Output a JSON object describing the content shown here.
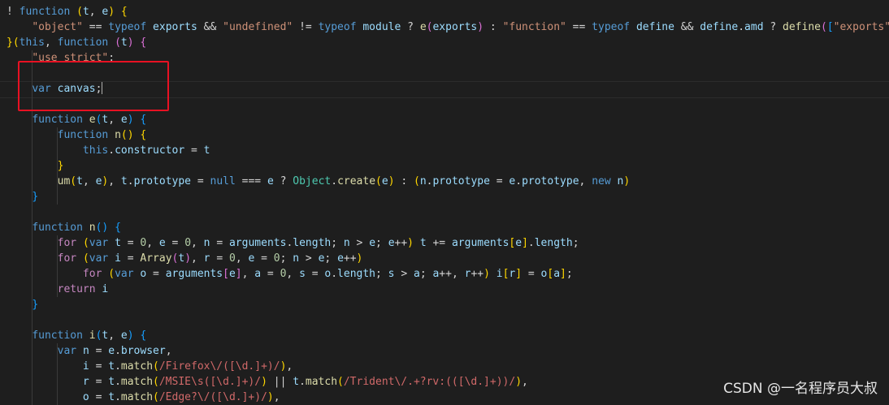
{
  "editor": {
    "language": "javascript",
    "theme": "dark",
    "cursor": {
      "line": 6,
      "after_text": "var canvas;"
    },
    "highlight": {
      "label": "red-annotation-box",
      "color": "#e81123"
    }
  },
  "watermark": "CSDN @一名程序员大叔",
  "lines": [
    [
      [
        "op",
        "! "
      ],
      [
        "kw",
        "function"
      ],
      [
        "op",
        " "
      ],
      [
        "br1",
        "("
      ],
      [
        "var",
        "t"
      ],
      [
        "op",
        ", "
      ],
      [
        "var",
        "e"
      ],
      [
        "br1",
        ")"
      ],
      [
        "op",
        " "
      ],
      [
        "br1",
        "{"
      ]
    ],
    [
      [
        "op",
        "    "
      ],
      [
        "str",
        "\"object\""
      ],
      [
        "op",
        " == "
      ],
      [
        "kw",
        "typeof"
      ],
      [
        "op",
        " "
      ],
      [
        "var",
        "exports"
      ],
      [
        "op",
        " && "
      ],
      [
        "str",
        "\"undefined\""
      ],
      [
        "op",
        " != "
      ],
      [
        "kw",
        "typeof"
      ],
      [
        "op",
        " "
      ],
      [
        "var",
        "module"
      ],
      [
        "op",
        " ? "
      ],
      [
        "fn",
        "e"
      ],
      [
        "br2",
        "("
      ],
      [
        "var",
        "exports"
      ],
      [
        "br2",
        ")"
      ],
      [
        "op",
        " : "
      ],
      [
        "str",
        "\"function\""
      ],
      [
        "op",
        " == "
      ],
      [
        "kw",
        "typeof"
      ],
      [
        "op",
        " "
      ],
      [
        "var",
        "define"
      ],
      [
        "op",
        " && "
      ],
      [
        "var",
        "define"
      ],
      [
        "op",
        "."
      ],
      [
        "var",
        "amd"
      ],
      [
        "op",
        " ? "
      ],
      [
        "fn",
        "define"
      ],
      [
        "br2",
        "("
      ],
      [
        "br3",
        "["
      ],
      [
        "str",
        "\"exports\""
      ],
      [
        "br3",
        "]"
      ],
      [
        "op",
        ","
      ]
    ],
    [
      [
        "br1",
        "}"
      ],
      [
        "br1",
        "("
      ],
      [
        "kw",
        "this"
      ],
      [
        "op",
        ", "
      ],
      [
        "kw",
        "function"
      ],
      [
        "op",
        " "
      ],
      [
        "br2",
        "("
      ],
      [
        "var",
        "t"
      ],
      [
        "br2",
        ")"
      ],
      [
        "op",
        " "
      ],
      [
        "br2",
        "{"
      ]
    ],
    [
      [
        "op",
        "    "
      ],
      [
        "str",
        "\"use strict\""
      ],
      [
        "op",
        ";"
      ]
    ],
    [
      [
        "op",
        ""
      ]
    ],
    [
      [
        "op",
        "    "
      ],
      [
        "kw",
        "var"
      ],
      [
        "op",
        " "
      ],
      [
        "var",
        "canvas"
      ],
      [
        "op",
        ";"
      ]
    ],
    [
      [
        "op",
        ""
      ]
    ],
    [
      [
        "op",
        "    "
      ],
      [
        "kw",
        "function"
      ],
      [
        "op",
        " "
      ],
      [
        "fn",
        "e"
      ],
      [
        "br3",
        "("
      ],
      [
        "var",
        "t"
      ],
      [
        "op",
        ", "
      ],
      [
        "var",
        "e"
      ],
      [
        "br3",
        ")"
      ],
      [
        "op",
        " "
      ],
      [
        "br3",
        "{"
      ]
    ],
    [
      [
        "op",
        "        "
      ],
      [
        "kw",
        "function"
      ],
      [
        "op",
        " "
      ],
      [
        "fn",
        "n"
      ],
      [
        "br1",
        "("
      ],
      [
        "br1",
        ")"
      ],
      [
        "op",
        " "
      ],
      [
        "br1",
        "{"
      ]
    ],
    [
      [
        "op",
        "            "
      ],
      [
        "kw",
        "this"
      ],
      [
        "op",
        "."
      ],
      [
        "var",
        "constructor"
      ],
      [
        "op",
        " = "
      ],
      [
        "var",
        "t"
      ]
    ],
    [
      [
        "op",
        "        "
      ],
      [
        "br1",
        "}"
      ]
    ],
    [
      [
        "op",
        "        "
      ],
      [
        "fn",
        "um"
      ],
      [
        "br1",
        "("
      ],
      [
        "var",
        "t"
      ],
      [
        "op",
        ", "
      ],
      [
        "var",
        "e"
      ],
      [
        "br1",
        ")"
      ],
      [
        "op",
        ", "
      ],
      [
        "var",
        "t"
      ],
      [
        "op",
        "."
      ],
      [
        "var",
        "prototype"
      ],
      [
        "op",
        " = "
      ],
      [
        "kw",
        "null"
      ],
      [
        "op",
        " === "
      ],
      [
        "var",
        "e"
      ],
      [
        "op",
        " ? "
      ],
      [
        "cls",
        "Object"
      ],
      [
        "op",
        "."
      ],
      [
        "fn",
        "create"
      ],
      [
        "br1",
        "("
      ],
      [
        "var",
        "e"
      ],
      [
        "br1",
        ")"
      ],
      [
        "op",
        " : "
      ],
      [
        "br1",
        "("
      ],
      [
        "var",
        "n"
      ],
      [
        "op",
        "."
      ],
      [
        "var",
        "prototype"
      ],
      [
        "op",
        " = "
      ],
      [
        "var",
        "e"
      ],
      [
        "op",
        "."
      ],
      [
        "var",
        "prototype"
      ],
      [
        "op",
        ", "
      ],
      [
        "kw",
        "new"
      ],
      [
        "op",
        " "
      ],
      [
        "var",
        "n"
      ],
      [
        "br1",
        ")"
      ]
    ],
    [
      [
        "op",
        "    "
      ],
      [
        "br3",
        "}"
      ]
    ],
    [
      [
        "op",
        ""
      ]
    ],
    [
      [
        "op",
        "    "
      ],
      [
        "kw",
        "function"
      ],
      [
        "op",
        " "
      ],
      [
        "fn",
        "n"
      ],
      [
        "br3",
        "("
      ],
      [
        "br3",
        ")"
      ],
      [
        "op",
        " "
      ],
      [
        "br3",
        "{"
      ]
    ],
    [
      [
        "op",
        "        "
      ],
      [
        "ctl",
        "for"
      ],
      [
        "op",
        " "
      ],
      [
        "br1",
        "("
      ],
      [
        "kw",
        "var"
      ],
      [
        "op",
        " "
      ],
      [
        "var",
        "t"
      ],
      [
        "op",
        " = "
      ],
      [
        "num",
        "0"
      ],
      [
        "op",
        ", "
      ],
      [
        "var",
        "e"
      ],
      [
        "op",
        " = "
      ],
      [
        "num",
        "0"
      ],
      [
        "op",
        ", "
      ],
      [
        "var",
        "n"
      ],
      [
        "op",
        " = "
      ],
      [
        "var",
        "arguments"
      ],
      [
        "op",
        "."
      ],
      [
        "var",
        "length"
      ],
      [
        "op",
        "; "
      ],
      [
        "var",
        "n"
      ],
      [
        "op",
        " > "
      ],
      [
        "var",
        "e"
      ],
      [
        "op",
        "; "
      ],
      [
        "var",
        "e"
      ],
      [
        "op",
        "++"
      ],
      [
        "br1",
        ")"
      ],
      [
        "op",
        " "
      ],
      [
        "var",
        "t"
      ],
      [
        "op",
        " += "
      ],
      [
        "var",
        "arguments"
      ],
      [
        "br1",
        "["
      ],
      [
        "var",
        "e"
      ],
      [
        "br1",
        "]"
      ],
      [
        "op",
        "."
      ],
      [
        "var",
        "length"
      ],
      [
        "op",
        ";"
      ]
    ],
    [
      [
        "op",
        "        "
      ],
      [
        "ctl",
        "for"
      ],
      [
        "op",
        " "
      ],
      [
        "br1",
        "("
      ],
      [
        "kw",
        "var"
      ],
      [
        "op",
        " "
      ],
      [
        "var",
        "i"
      ],
      [
        "op",
        " = "
      ],
      [
        "fn",
        "Array"
      ],
      [
        "br2",
        "("
      ],
      [
        "var",
        "t"
      ],
      [
        "br2",
        ")"
      ],
      [
        "op",
        ", "
      ],
      [
        "var",
        "r"
      ],
      [
        "op",
        " = "
      ],
      [
        "num",
        "0"
      ],
      [
        "op",
        ", "
      ],
      [
        "var",
        "e"
      ],
      [
        "op",
        " = "
      ],
      [
        "num",
        "0"
      ],
      [
        "op",
        "; "
      ],
      [
        "var",
        "n"
      ],
      [
        "op",
        " > "
      ],
      [
        "var",
        "e"
      ],
      [
        "op",
        "; "
      ],
      [
        "var",
        "e"
      ],
      [
        "op",
        "++"
      ],
      [
        "br1",
        ")"
      ]
    ],
    [
      [
        "op",
        "            "
      ],
      [
        "ctl",
        "for"
      ],
      [
        "op",
        " "
      ],
      [
        "br1",
        "("
      ],
      [
        "kw",
        "var"
      ],
      [
        "op",
        " "
      ],
      [
        "var",
        "o"
      ],
      [
        "op",
        " = "
      ],
      [
        "var",
        "arguments"
      ],
      [
        "br2",
        "["
      ],
      [
        "var",
        "e"
      ],
      [
        "br2",
        "]"
      ],
      [
        "op",
        ", "
      ],
      [
        "var",
        "a"
      ],
      [
        "op",
        " = "
      ],
      [
        "num",
        "0"
      ],
      [
        "op",
        ", "
      ],
      [
        "var",
        "s"
      ],
      [
        "op",
        " = "
      ],
      [
        "var",
        "o"
      ],
      [
        "op",
        "."
      ],
      [
        "var",
        "length"
      ],
      [
        "op",
        "; "
      ],
      [
        "var",
        "s"
      ],
      [
        "op",
        " > "
      ],
      [
        "var",
        "a"
      ],
      [
        "op",
        "; "
      ],
      [
        "var",
        "a"
      ],
      [
        "op",
        "++, "
      ],
      [
        "var",
        "r"
      ],
      [
        "op",
        "++"
      ],
      [
        "br1",
        ")"
      ],
      [
        "op",
        " "
      ],
      [
        "var",
        "i"
      ],
      [
        "br1",
        "["
      ],
      [
        "var",
        "r"
      ],
      [
        "br1",
        "]"
      ],
      [
        "op",
        " = "
      ],
      [
        "var",
        "o"
      ],
      [
        "br1",
        "["
      ],
      [
        "var",
        "a"
      ],
      [
        "br1",
        "]"
      ],
      [
        "op",
        ";"
      ]
    ],
    [
      [
        "op",
        "        "
      ],
      [
        "ctl",
        "return"
      ],
      [
        "op",
        " "
      ],
      [
        "var",
        "i"
      ]
    ],
    [
      [
        "op",
        "    "
      ],
      [
        "br3",
        "}"
      ]
    ],
    [
      [
        "op",
        ""
      ]
    ],
    [
      [
        "op",
        "    "
      ],
      [
        "kw",
        "function"
      ],
      [
        "op",
        " "
      ],
      [
        "fn",
        "i"
      ],
      [
        "br3",
        "("
      ],
      [
        "var",
        "t"
      ],
      [
        "op",
        ", "
      ],
      [
        "var",
        "e"
      ],
      [
        "br3",
        ")"
      ],
      [
        "op",
        " "
      ],
      [
        "br3",
        "{"
      ]
    ],
    [
      [
        "op",
        "        "
      ],
      [
        "kw",
        "var"
      ],
      [
        "op",
        " "
      ],
      [
        "var",
        "n"
      ],
      [
        "op",
        " = "
      ],
      [
        "var",
        "e"
      ],
      [
        "op",
        "."
      ],
      [
        "var",
        "browser"
      ],
      [
        "op",
        ","
      ]
    ],
    [
      [
        "op",
        "            "
      ],
      [
        "var",
        "i"
      ],
      [
        "op",
        " = "
      ],
      [
        "var",
        "t"
      ],
      [
        "op",
        "."
      ],
      [
        "fn",
        "match"
      ],
      [
        "br1",
        "("
      ],
      [
        "rx",
        "/Firefox\\/([\\d.]+)/"
      ],
      [
        "br1",
        ")"
      ],
      [
        "op",
        ","
      ]
    ],
    [
      [
        "op",
        "            "
      ],
      [
        "var",
        "r"
      ],
      [
        "op",
        " = "
      ],
      [
        "var",
        "t"
      ],
      [
        "op",
        "."
      ],
      [
        "fn",
        "match"
      ],
      [
        "br1",
        "("
      ],
      [
        "rx",
        "/MSIE\\s([\\d.]+)/"
      ],
      [
        "br1",
        ")"
      ],
      [
        "op",
        " || "
      ],
      [
        "var",
        "t"
      ],
      [
        "op",
        "."
      ],
      [
        "fn",
        "match"
      ],
      [
        "br1",
        "("
      ],
      [
        "rx",
        "/Trident\\/.+?rv:(([\\d.]+))/"
      ],
      [
        "br1",
        ")"
      ],
      [
        "op",
        ","
      ]
    ],
    [
      [
        "op",
        "            "
      ],
      [
        "var",
        "o"
      ],
      [
        "op",
        " = "
      ],
      [
        "var",
        "t"
      ],
      [
        "op",
        "."
      ],
      [
        "fn",
        "match"
      ],
      [
        "br1",
        "("
      ],
      [
        "rx",
        "/Edge?\\/([\\d.]+)/"
      ],
      [
        "br1",
        ")"
      ],
      [
        "op",
        ","
      ]
    ]
  ]
}
